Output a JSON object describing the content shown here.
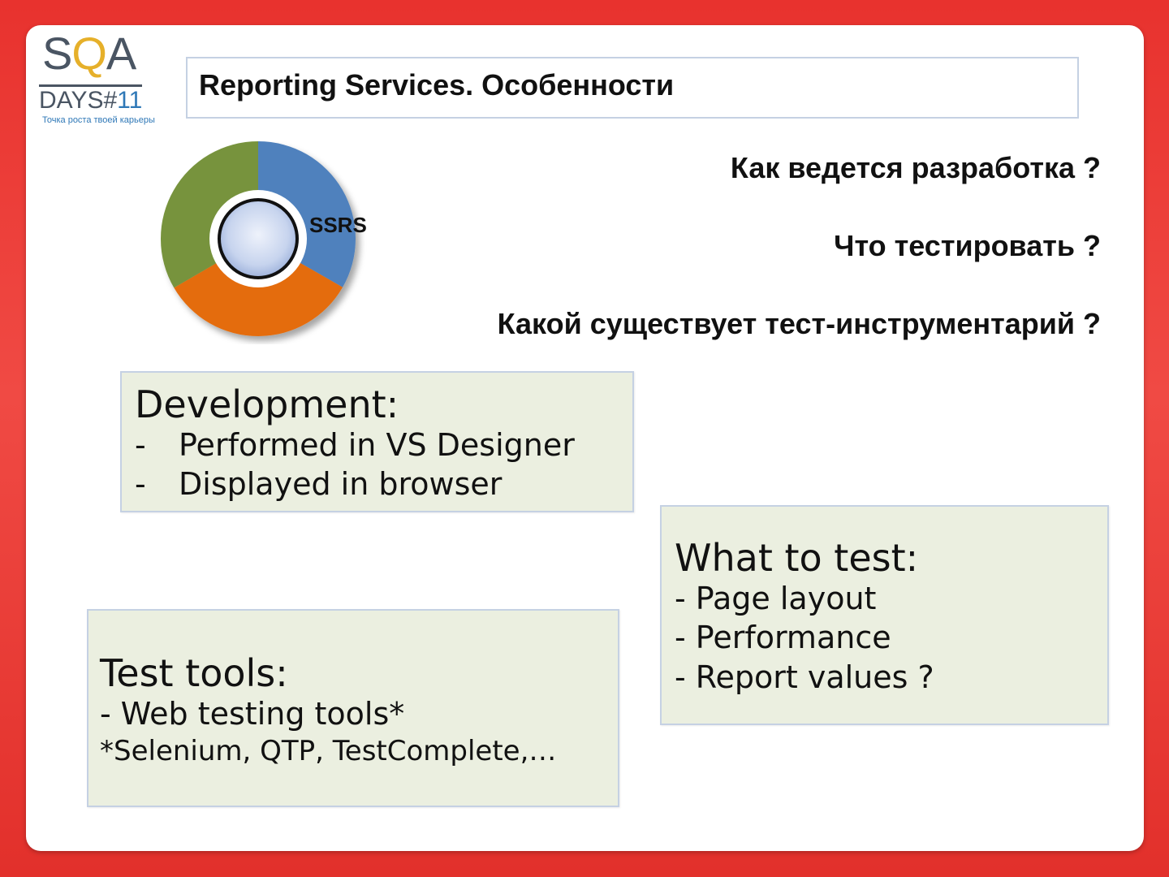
{
  "logo": {
    "brand_letters_1": "S",
    "brand_letters_2": "Q",
    "brand_letters_3": "A",
    "days_label": "DAYS#",
    "days_number": "11",
    "tagline": "Точка роста твоей карьеры"
  },
  "title": "Reporting Services. Особенности",
  "questions": [
    "Как ведется разработка ?",
    "Что тестировать ?",
    "Какой существует тест-инструментарий ?"
  ],
  "diagram": {
    "label": "SSRS",
    "segments": [
      {
        "color": "#4f81bd",
        "fraction": 0.333
      },
      {
        "color": "#e46c0a",
        "fraction": 0.333
      },
      {
        "color": "#77933c",
        "fraction": 0.334
      }
    ]
  },
  "development": {
    "heading": "Development:",
    "dash": "-",
    "items": [
      "Performed in VS Designer",
      "Displayed in browser"
    ]
  },
  "what_to_test": {
    "heading": "What to test:",
    "items": [
      "- Page layout",
      "- Performance",
      "- Report values ?"
    ]
  },
  "test_tools": {
    "heading": "Test tools:",
    "item": "- Web testing tools*",
    "note": "*Selenium, QTP, TestComplete,…"
  },
  "colors": {
    "frame_red": "#e8322e",
    "box_fill": "#ebefe0",
    "box_border": "#c5d1e3"
  }
}
